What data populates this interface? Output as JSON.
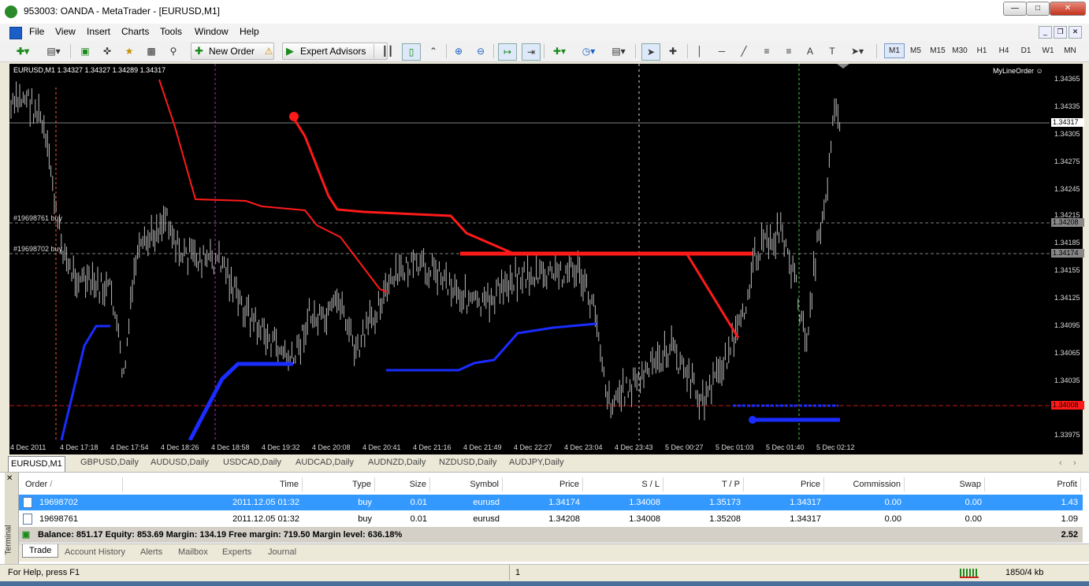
{
  "window": {
    "title": "953003: OANDA - MetaTrader - [EURUSD,M1]"
  },
  "menu": [
    "File",
    "View",
    "Insert",
    "Charts",
    "Tools",
    "Window",
    "Help"
  ],
  "toolbar": {
    "new_order": "New Order",
    "expert_advisors": "Expert Advisors",
    "timeframes": [
      "M1",
      "M5",
      "M15",
      "M30",
      "H1",
      "H4",
      "D1",
      "W1",
      "MN"
    ],
    "active_timeframe": "M1"
  },
  "chart": {
    "info": "EURUSD,M1  1.34327 1.34327 1.34289 1.34317",
    "indicator": "MyLineOrder ☺",
    "order_labels": [
      "#19698761 buy",
      "#19698702 buy"
    ],
    "price_labels": [
      "1.34365",
      "1.34335",
      "1.34305",
      "1.34275",
      "1.34245",
      "1.34215",
      "1.34185",
      "1.34155",
      "1.34125",
      "1.34095",
      "1.34065",
      "1.34035",
      "1.33975"
    ],
    "price_boxes": {
      "bid": "1.34317",
      "order1": "1.34208",
      "order2": "1.34174",
      "sl": "1.34008"
    },
    "time_labels": [
      "4 Dec 2011",
      "4 Dec 17:18",
      "4 Dec 17:54",
      "4 Dec 18:26",
      "4 Dec 18:58",
      "4 Dec 19:32",
      "4 Dec 20:08",
      "4 Dec 20:41",
      "4 Dec 21:16",
      "4 Dec 21:49",
      "4 Dec 22:27",
      "4 Dec 23:04",
      "4 Dec 23:43",
      "5 Dec 00:27",
      "5 Dec 01:03",
      "5 Dec 01:40",
      "5 Dec 02:12"
    ],
    "colors": {
      "background": "#000000",
      "red_line": "#ff1a1a",
      "blue_line": "#1a2cff",
      "candles": "#bdbdbd"
    }
  },
  "chart_tabs": [
    "EURUSD,M1",
    "GBPUSD,Daily",
    "AUDUSD,Daily",
    "USDCAD,Daily",
    "AUDCAD,Daily",
    "AUDNZD,Daily",
    "NZDUSD,Daily",
    "AUDJPY,Daily"
  ],
  "terminal": {
    "side_label": "Terminal",
    "columns": [
      "Order",
      "Time",
      "Type",
      "Size",
      "Symbol",
      "Price",
      "S / L",
      "T / P",
      "Price",
      "Commission",
      "Swap",
      "Profit"
    ],
    "sort_indicator": "/",
    "rows": [
      {
        "order": "19698702",
        "time": "2011.12.05 01:32",
        "type": "buy",
        "size": "0.01",
        "symbol": "eurusd",
        "price": "1.34174",
        "sl": "1.34008",
        "tp": "1.35173",
        "cur_price": "1.34317",
        "commission": "0.00",
        "swap": "0.00",
        "profit": "1.43"
      },
      {
        "order": "19698761",
        "time": "2011.12.05 01:32",
        "type": "buy",
        "size": "0.01",
        "symbol": "eurusd",
        "price": "1.34208",
        "sl": "1.34008",
        "tp": "1.35208",
        "cur_price": "1.34317",
        "commission": "0.00",
        "swap": "0.00",
        "profit": "1.09"
      }
    ],
    "summary": "Balance: 851.17  Equity: 853.69  Margin: 134.19  Free margin: 719.50  Margin level: 636.18%",
    "summary_profit": "2.52",
    "tabs": [
      "Trade",
      "Account History",
      "Alerts",
      "Mailbox",
      "Experts",
      "Journal"
    ]
  },
  "status": {
    "help": "For Help, press F1",
    "profile": "1",
    "traffic": "1850/4 kb"
  }
}
